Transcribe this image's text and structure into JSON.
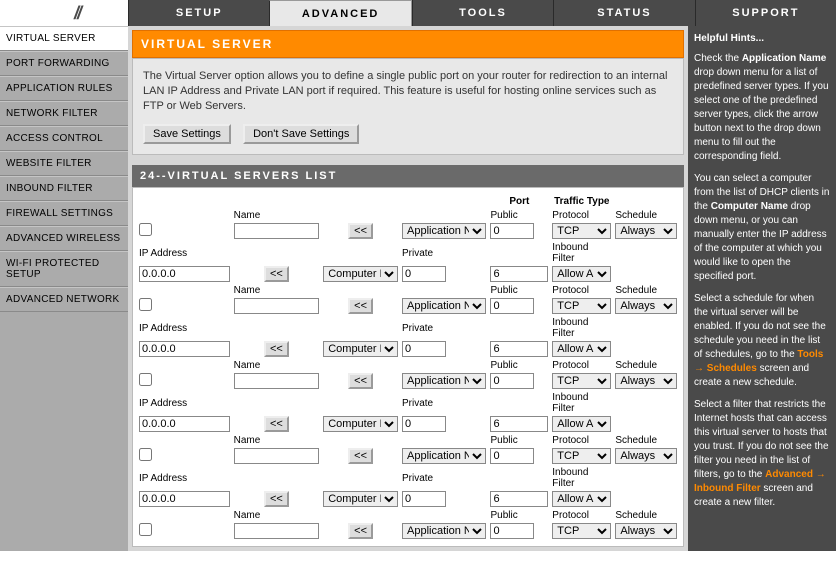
{
  "top_tabs": [
    "SETUP",
    "ADVANCED",
    "TOOLS",
    "STATUS",
    "SUPPORT"
  ],
  "top_active": 1,
  "sidebar": {
    "items": [
      "VIRTUAL SERVER",
      "PORT FORWARDING",
      "APPLICATION RULES",
      "NETWORK FILTER",
      "ACCESS CONTROL",
      "WEBSITE FILTER",
      "INBOUND FILTER",
      "FIREWALL SETTINGS",
      "ADVANCED WIRELESS",
      "WI-FI PROTECTED SETUP",
      "ADVANCED NETWORK"
    ],
    "active": 0
  },
  "panel": {
    "title": "VIRTUAL SERVER",
    "desc": "The Virtual Server option allows you to define a single public port on your router for redirection to an internal LAN IP Address and Private LAN port if required. This feature is useful for hosting online services such as FTP or Web Servers.",
    "save": "Save Settings",
    "dont": "Don't Save Settings"
  },
  "list": {
    "title": "24--VIRTUAL SERVERS LIST",
    "headers": {
      "port": "Port",
      "traffic": "Traffic Type"
    },
    "labels": {
      "name": "Name",
      "ip": "IP Address",
      "public": "Public",
      "private": "Private",
      "protocol": "Protocol",
      "schedule": "Schedule",
      "inbound": "Inbound Filter"
    },
    "arrow": "<<",
    "app_opt": "Application Name",
    "comp_opt": "Computer Name",
    "proto_opt": "TCP",
    "sched_opt": "Always",
    "filter_opt": "Allow All",
    "rows": [
      {
        "name": "",
        "ip": "0.0.0.0",
        "pub": "0",
        "priv": "0",
        "proto_other": "6"
      },
      {
        "name": "",
        "ip": "0.0.0.0",
        "pub": "0",
        "priv": "0",
        "proto_other": "6"
      },
      {
        "name": "",
        "ip": "0.0.0.0",
        "pub": "0",
        "priv": "0",
        "proto_other": "6"
      },
      {
        "name": "",
        "ip": "0.0.0.0",
        "pub": "0",
        "priv": "0",
        "proto_other": "6"
      },
      {
        "name": "",
        "ip": "",
        "pub": "0",
        "priv": "",
        "proto_other": ""
      }
    ]
  },
  "hints": {
    "title": "Helpful Hints...",
    "p1a": "Check the ",
    "p1b": "Application Name",
    "p1c": " drop down menu for a list of predefined server types. If you select one of the predefined server types, click the arrow button next to the drop down menu to fill out the corresponding field.",
    "p2a": "You can select a computer from the list of DHCP clients in the ",
    "p2b": "Computer Name",
    "p2c": " drop down menu, or you can manually enter the IP address of the computer at which you would like to open the specified port.",
    "p3a": "Select a schedule for when the virtual server will be enabled. If you do not see the schedule you need in the list of schedules, go to the ",
    "p3_link": "Tools → Schedules",
    "p3b": " screen and create a new schedule.",
    "p4a": "Select a filter that restricts the Internet hosts that can access this virtual server to hosts that you trust. If you do not see the filter you need in the list of filters, go to the ",
    "p4_link": "Advanced → Inbound Filter",
    "p4b": " screen and create a new filter."
  }
}
